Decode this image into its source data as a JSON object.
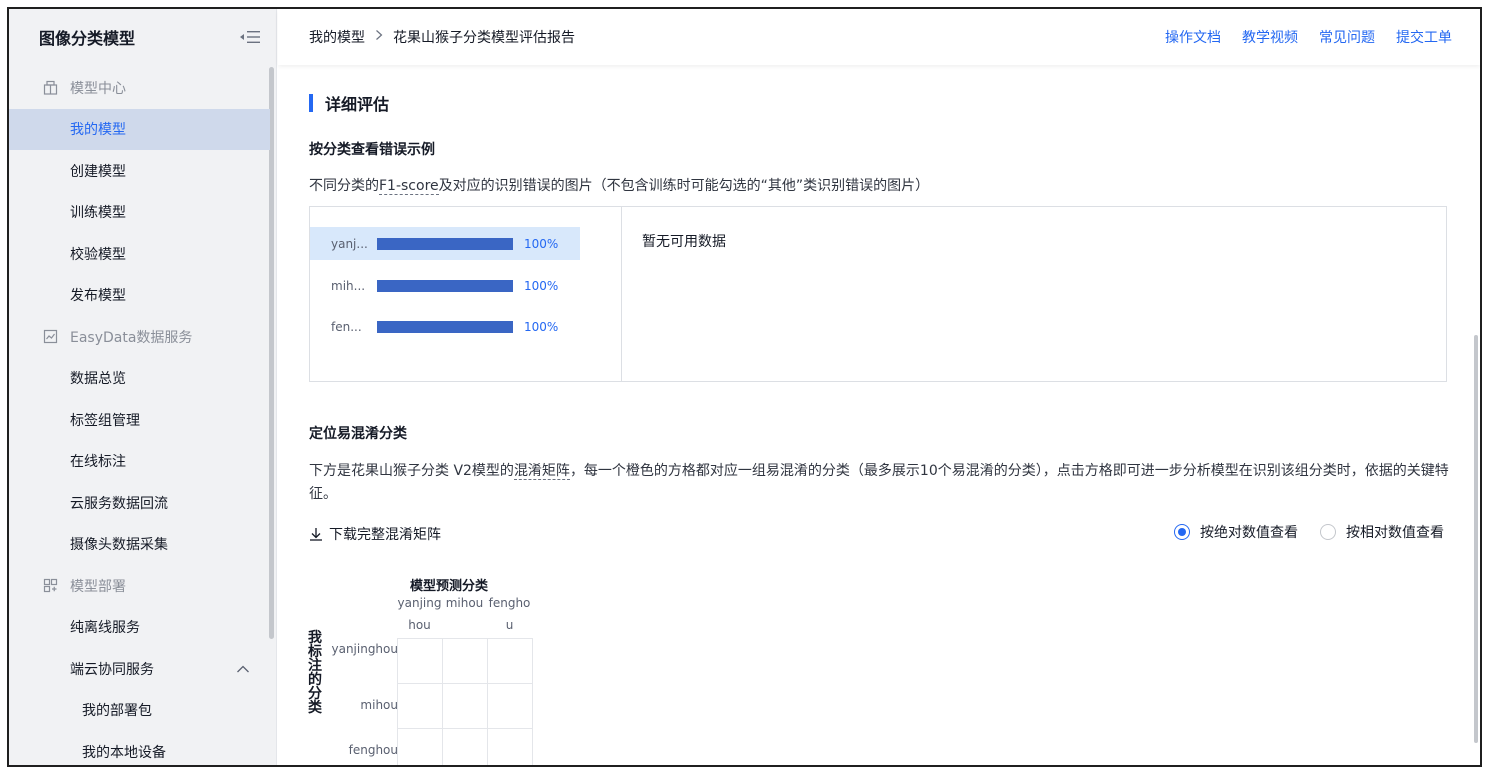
{
  "sidebar": {
    "title": "图像分类模型",
    "groups": {
      "model_center": {
        "label": "模型中心",
        "items": [
          "我的模型",
          "创建模型",
          "训练模型",
          "校验模型",
          "发布模型"
        ]
      },
      "easydata": {
        "label": "EasyData数据服务",
        "items": [
          "数据总览",
          "标签组管理",
          "在线标注",
          "云服务数据回流",
          "摄像头数据采集"
        ]
      },
      "deploy": {
        "label": "模型部署",
        "items": [
          "纯离线服务",
          "端云协同服务"
        ],
        "subitems": [
          "我的部署包",
          "我的本地设备"
        ]
      }
    }
  },
  "breadcrumb": {
    "root": "我的模型",
    "current": "花果山猴子分类模型评估报告"
  },
  "toplinks": [
    "操作文档",
    "教学视频",
    "常见问题",
    "提交工单"
  ],
  "main": {
    "section_title": "详细评估",
    "error_examples": {
      "title": "按分类查看错误示例",
      "desc_prefix": "不同分类的",
      "desc_term": "F1-score",
      "desc_suffix": "及对应的识别错误的图片（不包含训练时可能勾选的“其他”类识别错误的图片）",
      "empty_text": "暂无可用数据",
      "rows": [
        {
          "name": "yanj...",
          "value": 1.0,
          "label": "100%"
        },
        {
          "name": "mih...",
          "value": 1.0,
          "label": "100%"
        },
        {
          "name": "fen...",
          "value": 1.0,
          "label": "100%"
        }
      ]
    },
    "confusion": {
      "title": "定位易混淆分类",
      "desc_prefix": "下方是花果山猴子分类 V2模型的",
      "desc_term": "混淆矩阵",
      "desc_suffix": "，每一个橙色的方格都对应一组易混淆的分类（最多展示10个易混淆的分类），点击方格即可进一步分析模型在识别该组分类时，依据的关键特征。",
      "download_label": "下载完整混淆矩阵",
      "radio_absolute": "按绝对数值查看",
      "radio_relative": "按相对数值查看",
      "pred_label": "模型预测分类",
      "true_label": "我标注的分类",
      "classes": [
        "yanjinghou",
        "mihou",
        "fenghou"
      ]
    }
  }
}
